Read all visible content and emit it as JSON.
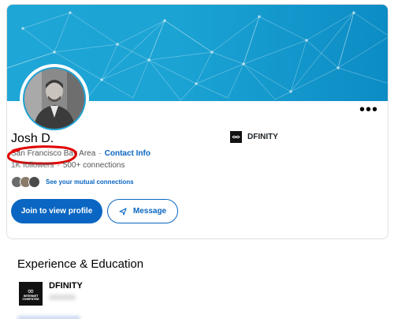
{
  "profile": {
    "name": "Josh D.",
    "location": "San Francisco Bay Area",
    "separator": "·",
    "contact_info": "Contact Info",
    "followers": "1K followers",
    "connections_sep": "·",
    "connections": "500+ connections",
    "mutual_connections": "See your mutual connections"
  },
  "actions": {
    "join_label": "Join to view profile",
    "message_label": "Message",
    "more_label": "•••"
  },
  "current_company": {
    "name": "DFINITY"
  },
  "experience": {
    "section_title": "Experience & Education",
    "items": [
      {
        "company": "DFINITY",
        "logo_text": "INTERNET COMPUTER"
      }
    ]
  },
  "colors": {
    "accent": "#0a66c2",
    "banner": "#1ba3d4",
    "annotation": "#e00000"
  },
  "icons": {
    "more": "more-horizontal-icon",
    "message": "send-icon"
  }
}
